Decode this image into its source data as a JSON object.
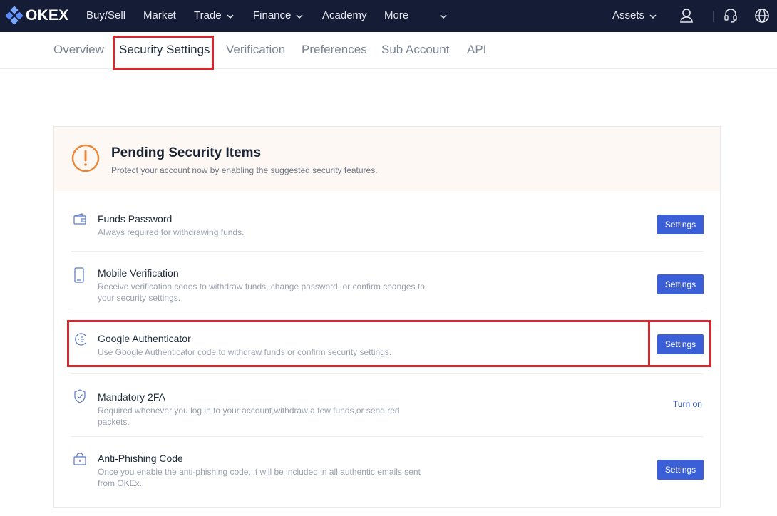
{
  "brand": {
    "name": "OKEX",
    "colors": {
      "topbar": "#151c35",
      "accent": "#3a5fd6",
      "highlight": "#d7282f",
      "warning": "#e8863a"
    }
  },
  "topnav": {
    "items": [
      {
        "label": "Buy/Sell",
        "dropdown": false
      },
      {
        "label": "Market",
        "dropdown": false
      },
      {
        "label": "Trade",
        "dropdown": true
      },
      {
        "label": "Finance",
        "dropdown": true
      },
      {
        "label": "Academy",
        "dropdown": false
      },
      {
        "label": "More",
        "dropdown": true
      }
    ],
    "assets_label": "Assets",
    "icons": [
      "user-icon",
      "headset-icon",
      "globe-icon"
    ]
  },
  "subnav": {
    "tabs": [
      {
        "label": "Overview",
        "active": false
      },
      {
        "label": "Security Settings",
        "active": true
      },
      {
        "label": "Verification",
        "active": false
      },
      {
        "label": "Preferences",
        "active": false
      },
      {
        "label": "Sub Account",
        "active": false
      },
      {
        "label": "API",
        "active": false
      }
    ]
  },
  "pending": {
    "title": "Pending Security Items",
    "subtitle": "Protect your account now by enabling the suggested security features.",
    "items": [
      {
        "icon": "wallet-icon",
        "title": "Funds Password",
        "desc": "Always required for withdrawing funds.",
        "action": "Settings"
      },
      {
        "icon": "mobile-icon",
        "title": "Mobile Verification",
        "desc": "Receive verification codes to withdraw funds, change password, or confirm changes to your security settings.",
        "action": "Settings"
      },
      {
        "icon": "authenticator-icon",
        "title": "Google Authenticator",
        "desc": "Use Google Authenticator code to withdraw funds or confirm security settings.",
        "action": "Settings"
      },
      {
        "icon": "shield-icon",
        "title": "Mandatory 2FA",
        "desc": "Required whenever you log in to your account,withdraw a few funds,or send red packets.",
        "action": "Turn on"
      },
      {
        "icon": "lock-box-icon",
        "title": "Anti-Phishing Code",
        "desc": "Once you enable the anti-phishing code, it will be included in all authentic emails sent from OKEx.",
        "action": "Settings"
      }
    ]
  }
}
